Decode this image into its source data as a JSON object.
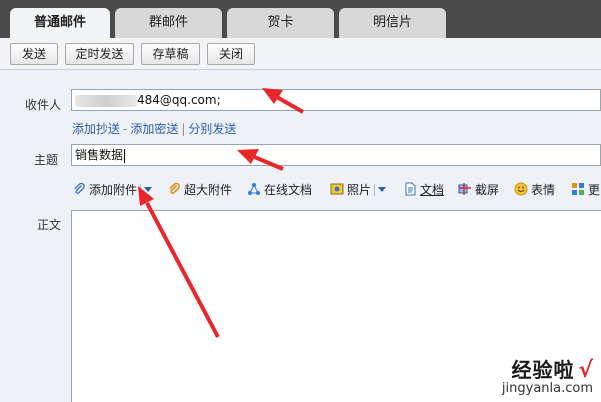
{
  "tabs": [
    {
      "label": "普通邮件",
      "active": true
    },
    {
      "label": "群邮件",
      "active": false
    },
    {
      "label": "贺卡",
      "active": false
    },
    {
      "label": "明信片",
      "active": false
    }
  ],
  "toolbar": {
    "send": "发送",
    "scheduled_send": "定时发送",
    "save_draft": "存草稿",
    "close": "关闭"
  },
  "form": {
    "to_label": "收件人",
    "to_value": "484@qq.com;",
    "add_cc": "添加抄送",
    "link_sep_dash": "-",
    "add_bcc": "添加密送",
    "link_sep_bar": "|",
    "send_separately": "分别发送",
    "subject_label": "主题",
    "subject_value": "销售数据",
    "body_label": "正文"
  },
  "attach_bar": {
    "add_attachment": "添加附件",
    "large_attachment": "超大附件",
    "online_doc": "在线文档",
    "photo": "照片",
    "document": "文档",
    "screenshot": "截屏",
    "emoji": "表情",
    "more": "更"
  },
  "watermark": {
    "cn": "经验啦",
    "check": "√",
    "url": "jingyanla.com"
  },
  "colors": {
    "annotation_arrow": "#e8262c",
    "link_blue": "#2a5db0",
    "topbar": "#4b4b4b"
  }
}
